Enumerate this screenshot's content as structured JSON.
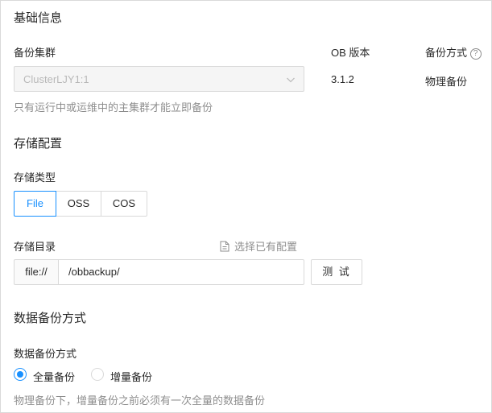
{
  "basic_info": {
    "title": "基础信息",
    "cluster_label": "备份集群",
    "cluster_value": "ClusterLJY1:1",
    "cluster_hint": "只有运行中或运维中的主集群才能立即备份",
    "ob_version_label": "OB 版本",
    "ob_version_value": "3.1.2",
    "backup_method_label": "备份方式",
    "backup_method_value": "物理备份",
    "help_icon_glyph": "?"
  },
  "storage": {
    "title": "存储配置",
    "type_label": "存储类型",
    "types": [
      {
        "label": "File",
        "selected": true
      },
      {
        "label": "OSS",
        "selected": false
      },
      {
        "label": "COS",
        "selected": false
      }
    ],
    "dir_label": "存储目录",
    "select_existing": "选择已有配置",
    "prefix": "file://",
    "dir_value": "/obbackup/",
    "test_button": "测 试"
  },
  "data_backup": {
    "title": "数据备份方式",
    "label": "数据备份方式",
    "options": [
      {
        "label": "全量备份",
        "selected": true
      },
      {
        "label": "增量备份",
        "selected": false
      }
    ],
    "hint": "物理备份下，增量备份之前必须有一次全量的数据备份"
  },
  "colors": {
    "primary": "#1890ff",
    "border": "#d9d9d9",
    "disabled_bg": "#f5f5f5"
  }
}
